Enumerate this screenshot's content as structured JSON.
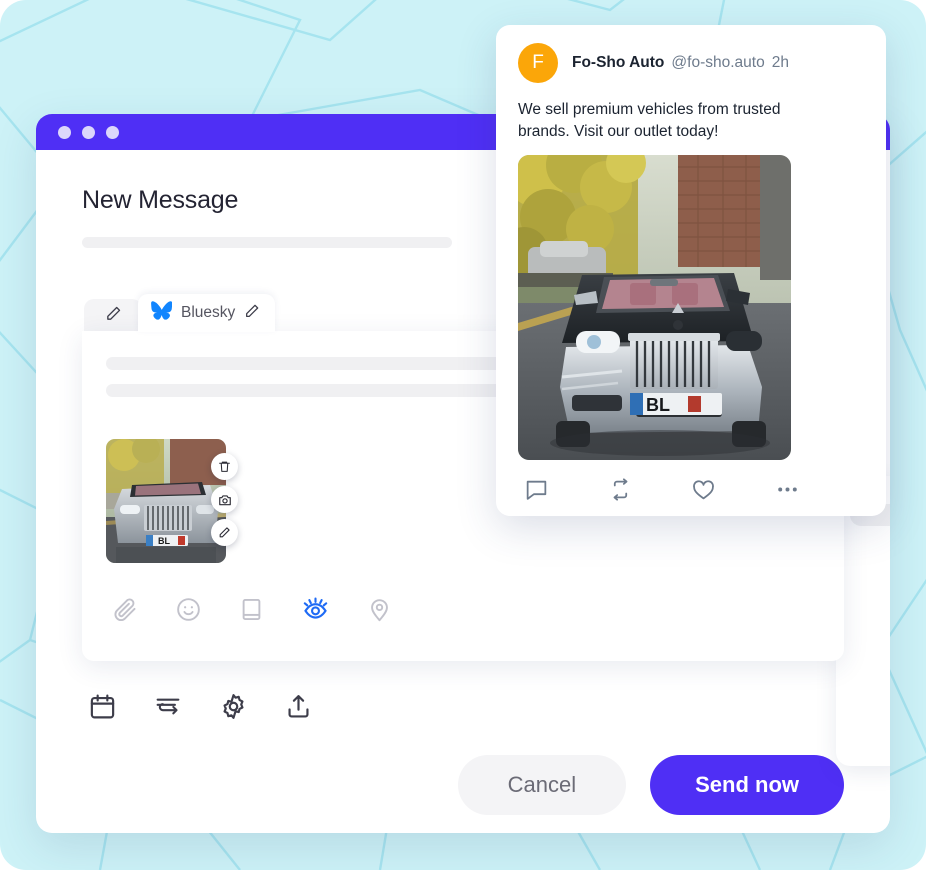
{
  "window": {
    "title": "New Message",
    "titlebar_dots": 3
  },
  "tabs": [
    {
      "id": "tab-generic",
      "label": "",
      "icon": "pencil-icon",
      "active": false
    },
    {
      "id": "tab-bluesky",
      "label": "Bluesky",
      "icon": "bluesky-butterfly-icon",
      "edit_icon": "pencil-icon",
      "active": true
    }
  ],
  "composer": {
    "placeholder_lines": 2,
    "attachment": {
      "alt": "Silver Rolls-Royce convertible parked on street",
      "actions": [
        {
          "id": "delete",
          "icon": "trash-icon"
        },
        {
          "id": "replace",
          "icon": "camera-icon"
        },
        {
          "id": "edit",
          "icon": "pencil-icon"
        }
      ]
    },
    "toolbar": [
      {
        "id": "attach",
        "icon": "paperclip-icon",
        "active": false
      },
      {
        "id": "emoji",
        "icon": "smiley-icon",
        "active": false
      },
      {
        "id": "saved-replies",
        "icon": "book-icon",
        "active": false
      },
      {
        "id": "preview",
        "icon": "eye-icon",
        "active": true
      },
      {
        "id": "location",
        "icon": "location-pin-icon",
        "active": false
      }
    ]
  },
  "bottom_toolbar": [
    {
      "id": "schedule",
      "icon": "calendar-icon"
    },
    {
      "id": "queue",
      "icon": "queue-arrow-icon"
    },
    {
      "id": "settings",
      "icon": "gear-icon"
    },
    {
      "id": "share",
      "icon": "upload-icon"
    }
  ],
  "footer": {
    "cancel_label": "Cancel",
    "send_label": "Send now"
  },
  "preview": {
    "avatar_initial": "F",
    "display_name": "Fo-Sho Auto",
    "handle": "@fo-sho.auto",
    "timestamp": "2h",
    "body": "We sell premium vehicles from trusted brands. Visit our outlet today!",
    "media_alt": "Silver Rolls-Royce convertible with pink interior parked by a brick wall",
    "actions": [
      {
        "id": "reply",
        "icon": "comment-icon"
      },
      {
        "id": "repost",
        "icon": "repost-icon"
      },
      {
        "id": "like",
        "icon": "heart-icon"
      },
      {
        "id": "more",
        "icon": "more-dots-icon"
      }
    ]
  },
  "colors": {
    "background": "#cdf2f7",
    "pattern_line": "#a6e4ef",
    "accent_purple": "#4f2ff5",
    "titlebar_dot": "#dcd6fb",
    "avatar_orange": "#fba609",
    "bluesky_blue": "#1185fe",
    "skeleton_gray": "#f0f0f2",
    "muted_text": "#6e7b8c"
  }
}
